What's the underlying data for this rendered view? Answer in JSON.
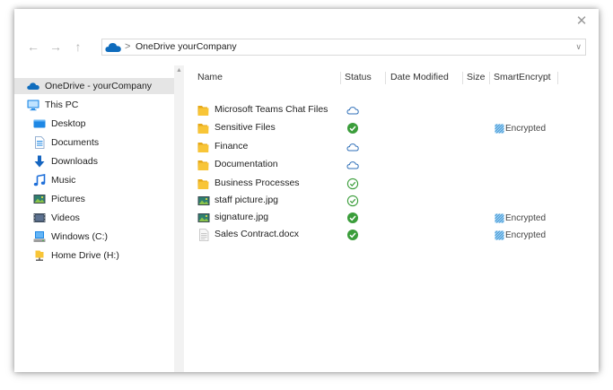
{
  "nav": {
    "back_icon": "arrow-left-icon",
    "forward_icon": "arrow-right-icon",
    "up_icon": "arrow-up-icon",
    "address": {
      "icon": "onedrive-cloud-icon",
      "separator": ">",
      "path": "OneDrive yourCompany"
    }
  },
  "sidebar": {
    "items": [
      {
        "label": "OneDrive - yourCompany",
        "icon": "onedrive-cloud-icon",
        "selected": true
      },
      {
        "label": "This PC",
        "icon": "monitor-icon"
      },
      {
        "label": "Desktop",
        "icon": "desktop-folder-icon"
      },
      {
        "label": "Documents",
        "icon": "documents-icon"
      },
      {
        "label": "Downloads",
        "icon": "download-arrow-icon"
      },
      {
        "label": "Music",
        "icon": "music-note-icon"
      },
      {
        "label": "Pictures",
        "icon": "pictures-icon"
      },
      {
        "label": "Videos",
        "icon": "videos-icon"
      },
      {
        "label": "Windows (C:)",
        "icon": "drive-c-icon"
      },
      {
        "label": "Home Drive (H:)",
        "icon": "network-drive-icon"
      }
    ]
  },
  "columns": [
    "Name",
    "Status",
    "Date Modified",
    "Size",
    "SmartEncrypt"
  ],
  "files": [
    {
      "name": "Microsoft Teams Chat Files",
      "icon": "folder-icon",
      "status": "cloud",
      "encrypted": ""
    },
    {
      "name": "Sensitive Files",
      "icon": "folder-icon",
      "status": "synced-filled",
      "encrypted": "Encrypted"
    },
    {
      "name": "Finance",
      "icon": "folder-icon",
      "status": "cloud",
      "encrypted": ""
    },
    {
      "name": "Documentation",
      "icon": "folder-icon",
      "status": "cloud",
      "encrypted": ""
    },
    {
      "name": "Business Processes",
      "icon": "folder-icon",
      "status": "available-outline",
      "encrypted": ""
    },
    {
      "name": "staff picture.jpg",
      "icon": "image-file-icon",
      "status": "available-outline",
      "encrypted": ""
    },
    {
      "name": "signature.jpg",
      "icon": "image-file-icon",
      "status": "synced-filled",
      "encrypted": "Encrypted"
    },
    {
      "name": "Sales Contract.docx",
      "icon": "document-file-icon",
      "status": "synced-filled",
      "encrypted": "Encrypted"
    }
  ],
  "colors": {
    "onedrive_blue": "#0f6cbd",
    "folder_yellow": "#f8c537",
    "status_green": "#3a9d3a",
    "cloud_outline": "#2f6fb8",
    "selected_bg": "#e5e5e5"
  }
}
